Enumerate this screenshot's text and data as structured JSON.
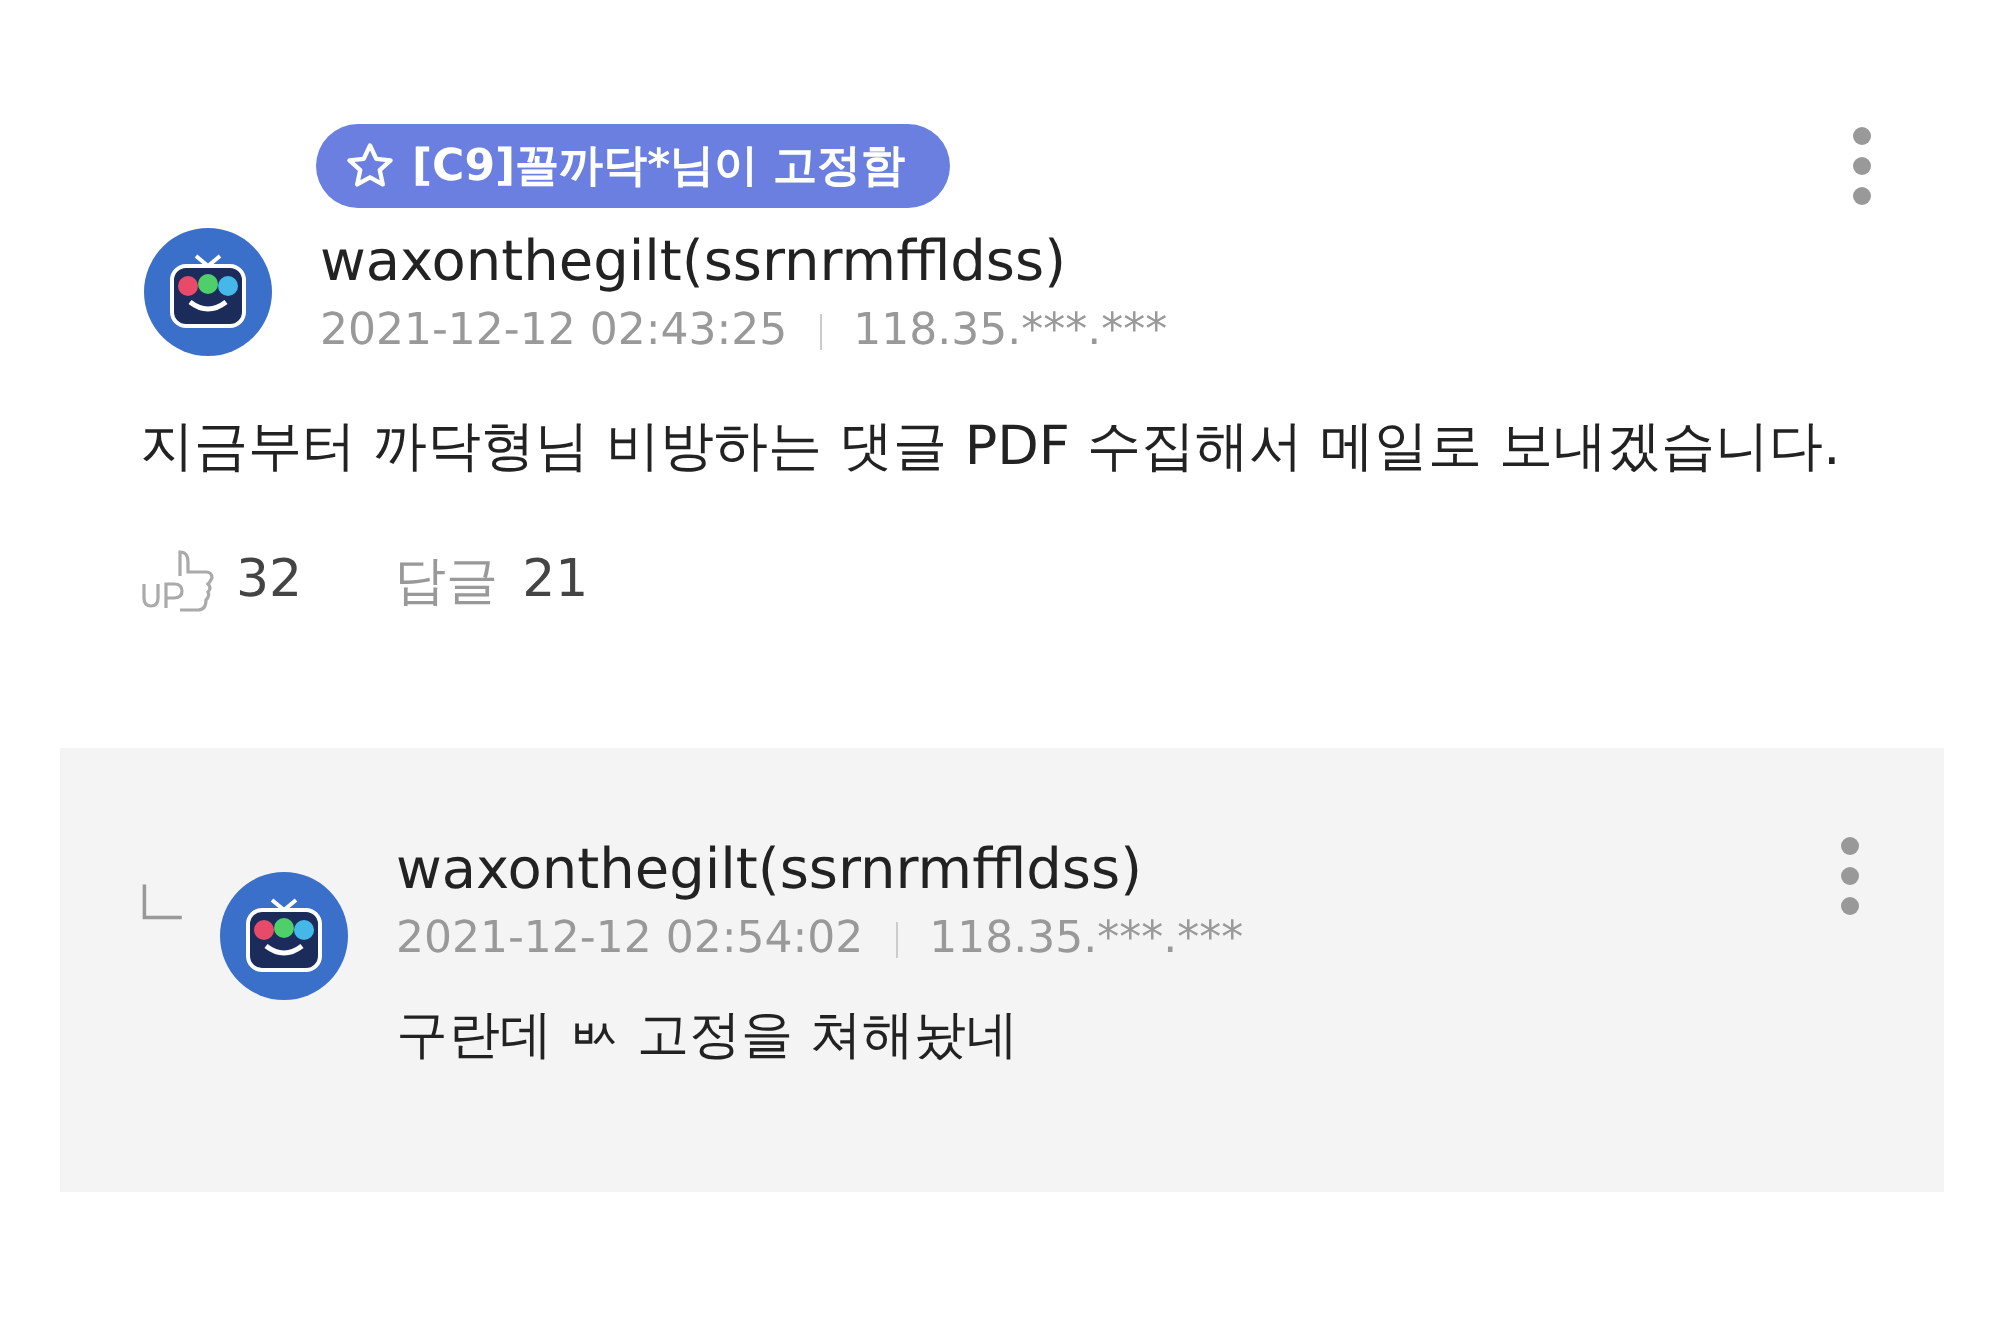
{
  "comment": {
    "pinned_badge": "[C9]꼴까닥*님이 고정함",
    "username": "waxonthegilt(ssrnrmffldss)",
    "date": "2021-12-12 02:43:25",
    "ip": "118.35.***.***",
    "body": "지금부터 까닥형님 비방하는 댓글 PDF 수집해서 메일로 보내겠습니다.",
    "likes": "32",
    "reply_label": "답글",
    "reply_count": "21"
  },
  "replies": [
    {
      "username": "waxonthegilt(ssrnrmffldss)",
      "date": "2021-12-12 02:54:02",
      "ip": "118.35.***.***",
      "body": "구란데 ㅄ 고정을 쳐해놨네"
    }
  ]
}
